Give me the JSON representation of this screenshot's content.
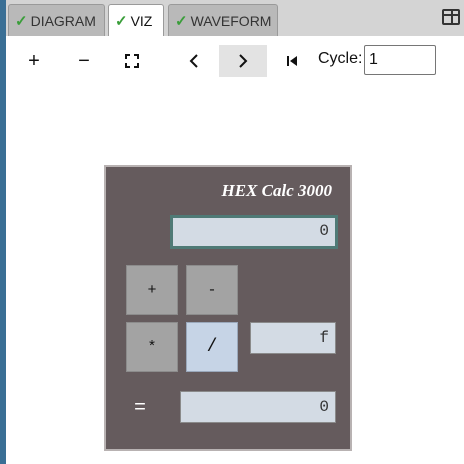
{
  "tabs": [
    {
      "label": "DIAGRAM",
      "status": "check"
    },
    {
      "label": "VIZ",
      "status": "check"
    },
    {
      "label": "WAVEFORM",
      "status": "check"
    }
  ],
  "active_tab": "VIZ",
  "toolbar": {
    "zoom_in": "+",
    "zoom_out": "−",
    "fit": "fullscreen-icon",
    "prev": "‹",
    "next": "›",
    "first": "skip-to-start-icon",
    "cycle_label": "Cycle:",
    "cycle_value": "1"
  },
  "calculator": {
    "title": "HEX Calc 3000",
    "main_display": "0",
    "keys": [
      "+",
      "-",
      "*",
      "/"
    ],
    "selected_key": "/",
    "operand_display": "f",
    "equals_label": "=",
    "result_display": "0"
  },
  "colors": {
    "calc_body": "#655b5d",
    "display_bg": "#d3dbe4",
    "key_bg": "#a3a3a3",
    "key_selected_bg": "#c6d4e6",
    "check": "#3a9e3a"
  }
}
